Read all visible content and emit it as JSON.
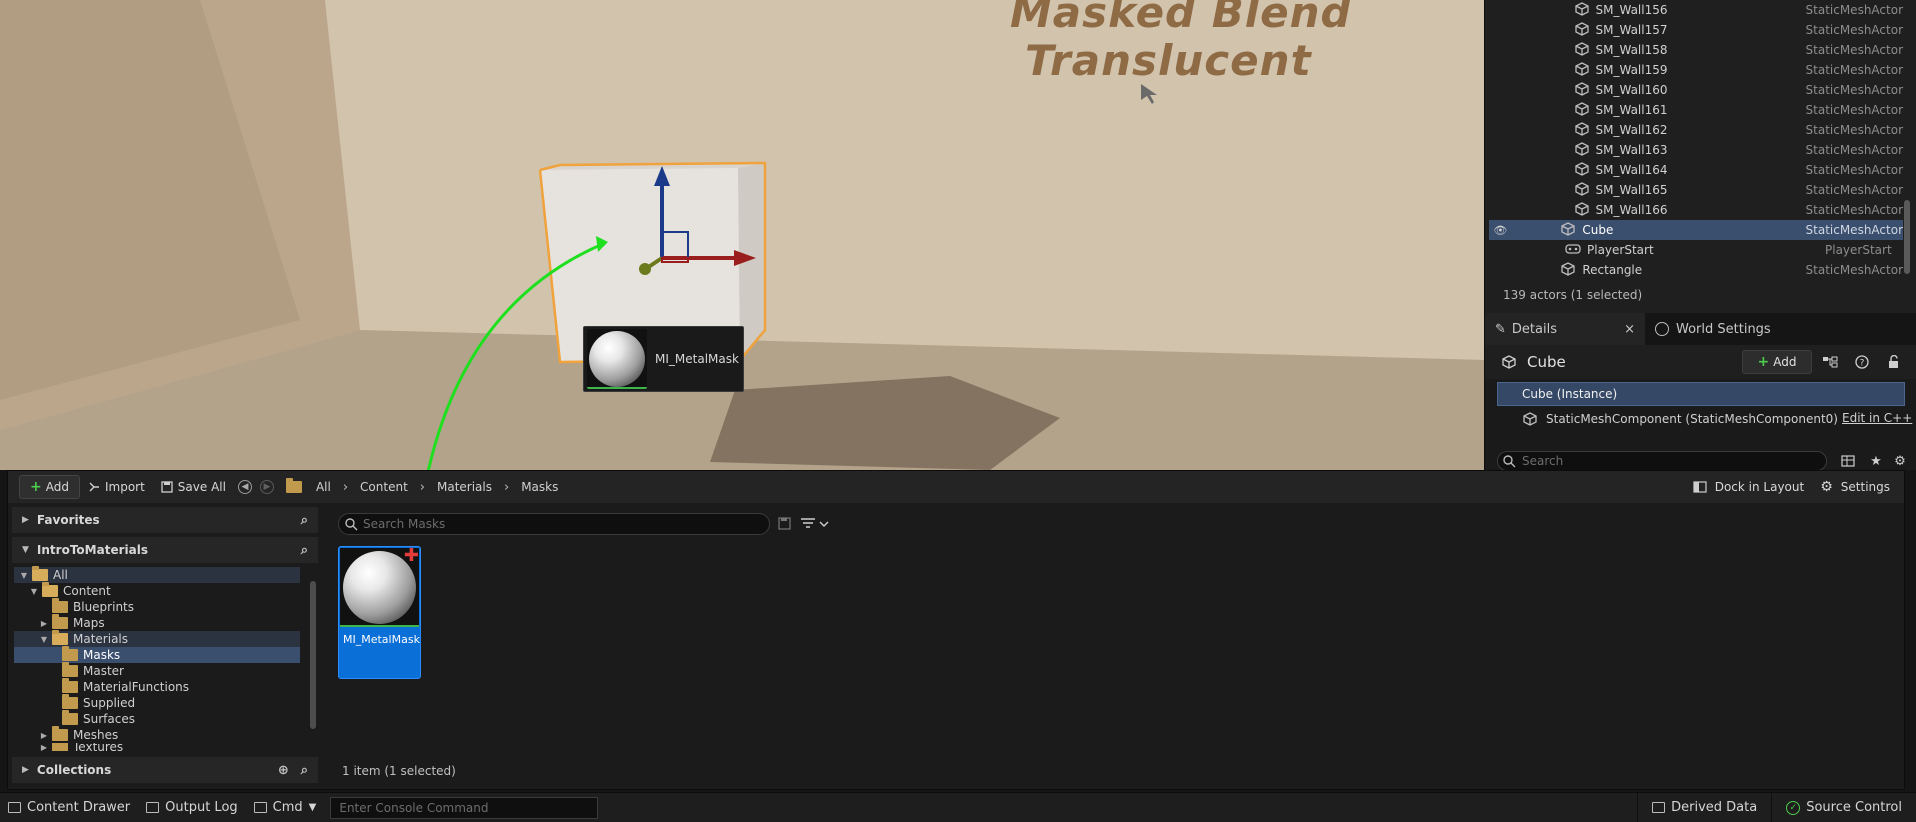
{
  "viewport": {
    "wall_text_line1": "Masked Blend",
    "wall_text_line2": "Translucent",
    "drag_preview_label": "MI_MetalMask"
  },
  "outliner": {
    "rows": [
      {
        "name": "SM_Wall156",
        "type": "StaticMeshActor"
      },
      {
        "name": "SM_Wall157",
        "type": "StaticMeshActor"
      },
      {
        "name": "SM_Wall158",
        "type": "StaticMeshActor"
      },
      {
        "name": "SM_Wall159",
        "type": "StaticMeshActor"
      },
      {
        "name": "SM_Wall160",
        "type": "StaticMeshActor"
      },
      {
        "name": "SM_Wall161",
        "type": "StaticMeshActor"
      },
      {
        "name": "SM_Wall162",
        "type": "StaticMeshActor"
      },
      {
        "name": "SM_Wall163",
        "type": "StaticMeshActor"
      },
      {
        "name": "SM_Wall164",
        "type": "StaticMeshActor"
      },
      {
        "name": "SM_Wall165",
        "type": "StaticMeshActor"
      },
      {
        "name": "SM_Wall166",
        "type": "StaticMeshActor"
      },
      {
        "name": "Cube",
        "type": "StaticMeshActor",
        "selected": true
      },
      {
        "name": "PlayerStart",
        "type": "PlayerStart"
      },
      {
        "name": "Rectangle",
        "type": "StaticMeshActor"
      }
    ],
    "footer": "139 actors (1 selected)"
  },
  "details": {
    "tab_details": "Details",
    "tab_close": "×",
    "tab_world_settings": "World Settings",
    "actor_name": "Cube",
    "add_label": "Add",
    "root_component": "Cube (Instance)",
    "child_component": "StaticMeshComponent (StaticMeshComponent0)",
    "edit_cpp_label": "Edit in C++",
    "search_placeholder": "Search"
  },
  "content_browser": {
    "toolbar": {
      "add_label": "Add",
      "import_label": "Import",
      "save_all_label": "Save All",
      "dock_label": "Dock in Layout",
      "settings_label": "Settings"
    },
    "breadcrumbs": [
      "All",
      "Content",
      "Materials",
      "Masks"
    ],
    "favorites_label": "Favorites",
    "project_label": "IntroToMaterials",
    "tree": [
      {
        "label": "All",
        "depth": 0,
        "twisty": "▼",
        "open": true
      },
      {
        "label": "Content",
        "depth": 1,
        "twisty": "▼",
        "open": true
      },
      {
        "label": "Blueprints",
        "depth": 2,
        "twisty": ""
      },
      {
        "label": "Maps",
        "depth": 2,
        "twisty": "▶"
      },
      {
        "label": "Materials",
        "depth": 2,
        "twisty": "▼",
        "open": true
      },
      {
        "label": "Masks",
        "depth": 3,
        "twisty": "",
        "selected": true
      },
      {
        "label": "Master",
        "depth": 3,
        "twisty": ""
      },
      {
        "label": "MaterialFunctions",
        "depth": 3,
        "twisty": ""
      },
      {
        "label": "Supplied",
        "depth": 3,
        "twisty": ""
      },
      {
        "label": "Surfaces",
        "depth": 3,
        "twisty": ""
      },
      {
        "label": "Meshes",
        "depth": 2,
        "twisty": "▶"
      },
      {
        "label": "Textures",
        "depth": 2,
        "twisty": "▶"
      }
    ],
    "collections_label": "Collections",
    "search_placeholder": "Search Masks",
    "asset_name": "MI_MetalMask",
    "item_count": "1 item (1 selected)"
  },
  "statusbar": {
    "content_drawer": "Content Drawer",
    "output_log": "Output Log",
    "cmd": "Cmd",
    "console_placeholder": "Enter Console Command",
    "derived_data": "Derived Data",
    "source_control": "Source Control"
  },
  "colors": {
    "selection": "#3a4e6e",
    "accent_blue": "#0a6fd6",
    "add_green": "#4ccb4c",
    "drag_arrow": "#1ee01e"
  }
}
